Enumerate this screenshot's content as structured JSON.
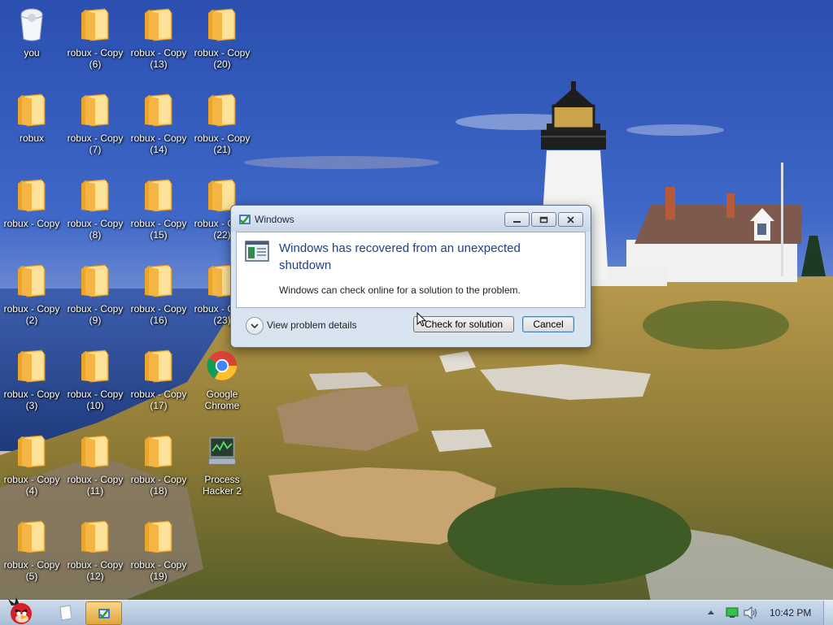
{
  "desktop": {
    "icons": [
      {
        "label": "you",
        "kind": "recycle-bin"
      },
      {
        "label": "robux - Copy (6)",
        "kind": "folder"
      },
      {
        "label": "robux - Copy (13)",
        "kind": "folder"
      },
      {
        "label": "robux - Copy (20)",
        "kind": "folder"
      },
      {
        "label": "robux",
        "kind": "folder"
      },
      {
        "label": "robux - Copy (7)",
        "kind": "folder"
      },
      {
        "label": "robux - Copy (14)",
        "kind": "folder"
      },
      {
        "label": "robux - Copy (21)",
        "kind": "folder"
      },
      {
        "label": "robux - Copy",
        "kind": "folder"
      },
      {
        "label": "robux - Copy (8)",
        "kind": "folder"
      },
      {
        "label": "robux - Copy (15)",
        "kind": "folder"
      },
      {
        "label": "robux - Copy (22)",
        "kind": "folder"
      },
      {
        "label": "robux - Copy (2)",
        "kind": "folder"
      },
      {
        "label": "robux - Copy (9)",
        "kind": "folder"
      },
      {
        "label": "robux - Copy (16)",
        "kind": "folder"
      },
      {
        "label": "robux - Copy (23)",
        "kind": "folder"
      },
      {
        "label": "robux - Copy (3)",
        "kind": "folder"
      },
      {
        "label": "robux - Copy (10)",
        "kind": "folder"
      },
      {
        "label": "robux - Copy (17)",
        "kind": "folder"
      },
      {
        "label": "Google Chrome",
        "kind": "chrome"
      },
      {
        "label": "robux - Copy (4)",
        "kind": "folder"
      },
      {
        "label": "robux - Copy (11)",
        "kind": "folder"
      },
      {
        "label": "robux - Copy (18)",
        "kind": "folder"
      },
      {
        "label": "Process Hacker 2",
        "kind": "process-hacker"
      },
      {
        "label": "robux - Copy (5)",
        "kind": "folder"
      },
      {
        "label": "robux - Copy (12)",
        "kind": "folder"
      },
      {
        "label": "robux - Copy (19)",
        "kind": "folder"
      }
    ]
  },
  "dialog": {
    "window_title": "Windows",
    "heading": "Windows has recovered from an unexpected shutdown",
    "subtext": "Windows can check online for a solution to the problem.",
    "details_label": "View problem details",
    "check_button": "Check for solution",
    "cancel_button": "Cancel"
  },
  "taskbar": {
    "clock": "10:42 PM",
    "accent_color": "#b9cce2"
  },
  "icons": {
    "folder": "folder-icon",
    "recycle": "recycle-bin-icon",
    "chrome": "chrome-icon",
    "process": "process-hacker-icon",
    "start": "start-angry-bird-icon"
  }
}
